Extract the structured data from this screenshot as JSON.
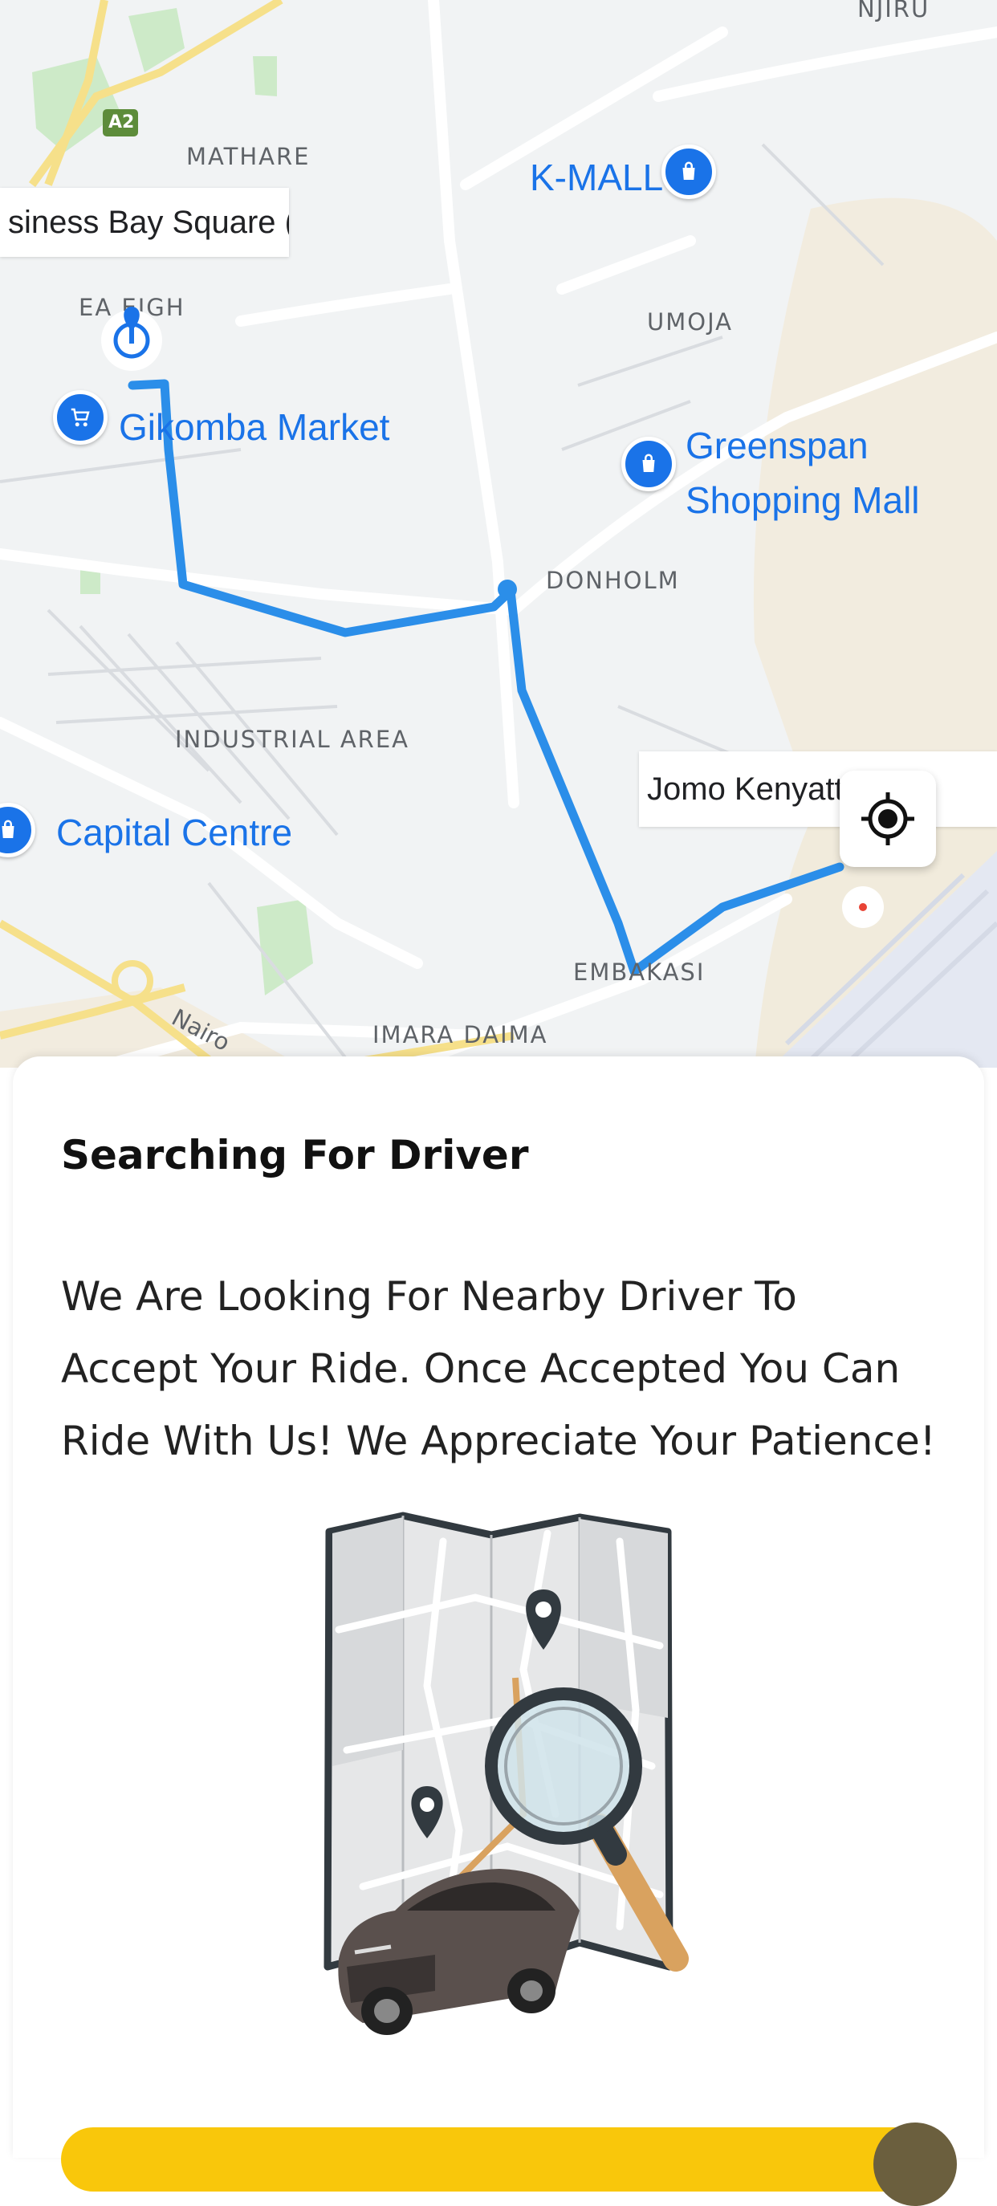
{
  "map": {
    "labels": {
      "njiru": "NJIRU",
      "mathare": "MATHARE",
      "eastleigh": "EA  EIGH",
      "umoja": "UMOJA",
      "donholm": "DONHOLM",
      "industrial_area": "INDUSTRIAL AREA",
      "embakasi": "EMBAKASI",
      "imara_daima": "IMARA DAIMA",
      "nairobi_road": "Nairo",
      "road_a2": "A2"
    },
    "pois": {
      "kmall": "K-MALL",
      "gikomba": "Gikomba Market",
      "greenspan_line1": "Greenspan",
      "greenspan_line2": "Shopping Mall",
      "capital_centre": "Capital Centre"
    },
    "callouts": {
      "pickup": "siness Bay Square (B",
      "destination": "Jomo Kenyatta    atio"
    },
    "icons": {
      "pickup_marker": "pickup-marker-icon",
      "locate": "my-location-icon",
      "shopping_bag": "shopping-bag-icon",
      "cart": "shopping-cart-icon"
    }
  },
  "sheet": {
    "title": "Searching For Driver",
    "description": "We Are Looking For Nearby Driver To Accept Your Ride. Once Accepted You Can Ride With Us! We Appreciate Your Patience!",
    "illustration": "map-search-car-illustration"
  },
  "colors": {
    "route": "#2b8ee9",
    "poi": "#1a73e8",
    "accent_button": "#f9c70b",
    "avatar": "#6b5f3e"
  }
}
